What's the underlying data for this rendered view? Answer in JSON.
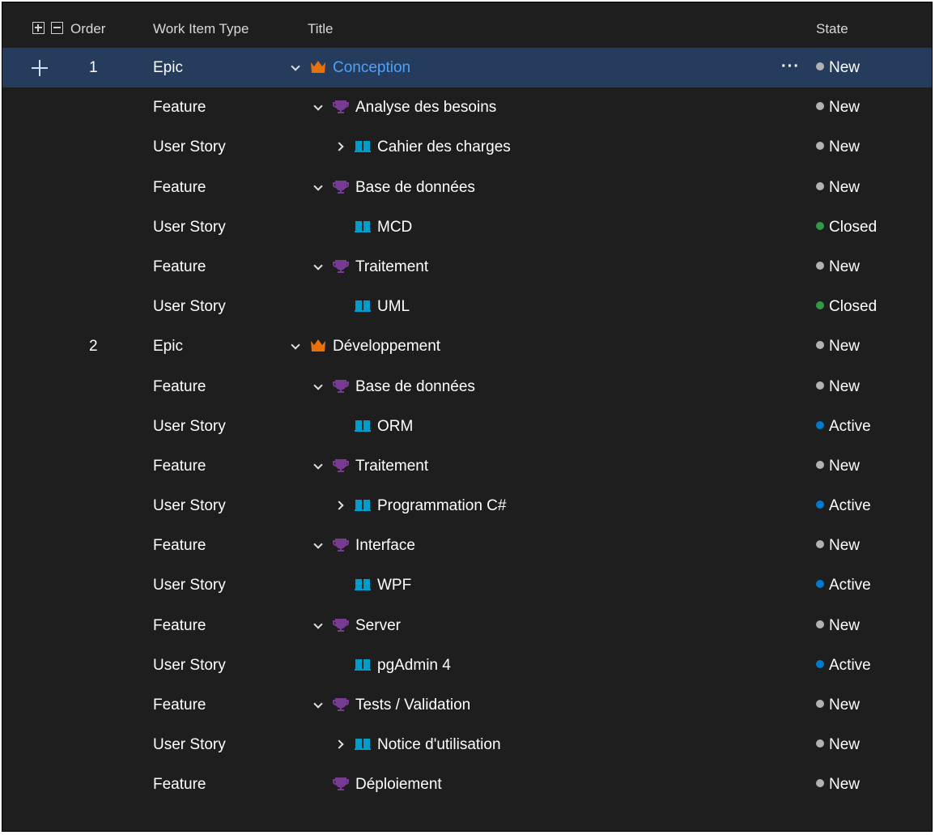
{
  "header": {
    "order_label": "Order",
    "type_label": "Work Item Type",
    "title_label": "Title",
    "state_label": "State"
  },
  "colors": {
    "epic": "#e8710a",
    "feature": "#773b93",
    "story": "#009ccc",
    "state_new": "#b2b2b2",
    "state_closed": "#339947",
    "state_active": "#007acc"
  },
  "rows": [
    {
      "order": "1",
      "type": "Epic",
      "kind": "epic",
      "depth": 0,
      "expand": "down",
      "title": "Conception",
      "state": "New",
      "state_kind": "new",
      "selected": true
    },
    {
      "order": "",
      "type": "Feature",
      "kind": "feature",
      "depth": 1,
      "expand": "down",
      "title": "Analyse des besoins",
      "state": "New",
      "state_kind": "new"
    },
    {
      "order": "",
      "type": "User Story",
      "kind": "story",
      "depth": 2,
      "expand": "right",
      "title": "Cahier des charges",
      "state": "New",
      "state_kind": "new"
    },
    {
      "order": "",
      "type": "Feature",
      "kind": "feature",
      "depth": 1,
      "expand": "down",
      "title": "Base de données",
      "state": "New",
      "state_kind": "new"
    },
    {
      "order": "",
      "type": "User Story",
      "kind": "story",
      "depth": 2,
      "expand": "",
      "title": "MCD",
      "state": "Closed",
      "state_kind": "closed"
    },
    {
      "order": "",
      "type": "Feature",
      "kind": "feature",
      "depth": 1,
      "expand": "down",
      "title": "Traitement",
      "state": "New",
      "state_kind": "new"
    },
    {
      "order": "",
      "type": "User Story",
      "kind": "story",
      "depth": 2,
      "expand": "",
      "title": "UML",
      "state": "Closed",
      "state_kind": "closed"
    },
    {
      "order": "2",
      "type": "Epic",
      "kind": "epic",
      "depth": 0,
      "expand": "down",
      "title": "Développement",
      "state": "New",
      "state_kind": "new"
    },
    {
      "order": "",
      "type": "Feature",
      "kind": "feature",
      "depth": 1,
      "expand": "down",
      "title": "Base de données",
      "state": "New",
      "state_kind": "new"
    },
    {
      "order": "",
      "type": "User Story",
      "kind": "story",
      "depth": 2,
      "expand": "",
      "title": "ORM",
      "state": "Active",
      "state_kind": "active"
    },
    {
      "order": "",
      "type": "Feature",
      "kind": "feature",
      "depth": 1,
      "expand": "down",
      "title": "Traitement",
      "state": "New",
      "state_kind": "new"
    },
    {
      "order": "",
      "type": "User Story",
      "kind": "story",
      "depth": 2,
      "expand": "right",
      "title": "Programmation C#",
      "state": "Active",
      "state_kind": "active"
    },
    {
      "order": "",
      "type": "Feature",
      "kind": "feature",
      "depth": 1,
      "expand": "down",
      "title": "Interface",
      "state": "New",
      "state_kind": "new"
    },
    {
      "order": "",
      "type": "User Story",
      "kind": "story",
      "depth": 2,
      "expand": "",
      "title": "WPF",
      "state": "Active",
      "state_kind": "active"
    },
    {
      "order": "",
      "type": "Feature",
      "kind": "feature",
      "depth": 1,
      "expand": "down",
      "title": "Server",
      "state": "New",
      "state_kind": "new"
    },
    {
      "order": "",
      "type": "User Story",
      "kind": "story",
      "depth": 2,
      "expand": "",
      "title": "pgAdmin 4",
      "state": "Active",
      "state_kind": "active"
    },
    {
      "order": "",
      "type": "Feature",
      "kind": "feature",
      "depth": 1,
      "expand": "down",
      "title": "Tests / Validation",
      "state": "New",
      "state_kind": "new"
    },
    {
      "order": "",
      "type": "User Story",
      "kind": "story",
      "depth": 2,
      "expand": "right",
      "title": "Notice d'utilisation",
      "state": "New",
      "state_kind": "new"
    },
    {
      "order": "",
      "type": "Feature",
      "kind": "feature",
      "depth": 1,
      "expand": "",
      "title": "Déploiement",
      "state": "New",
      "state_kind": "new"
    }
  ],
  "row_actions": {
    "more_label": "···"
  }
}
